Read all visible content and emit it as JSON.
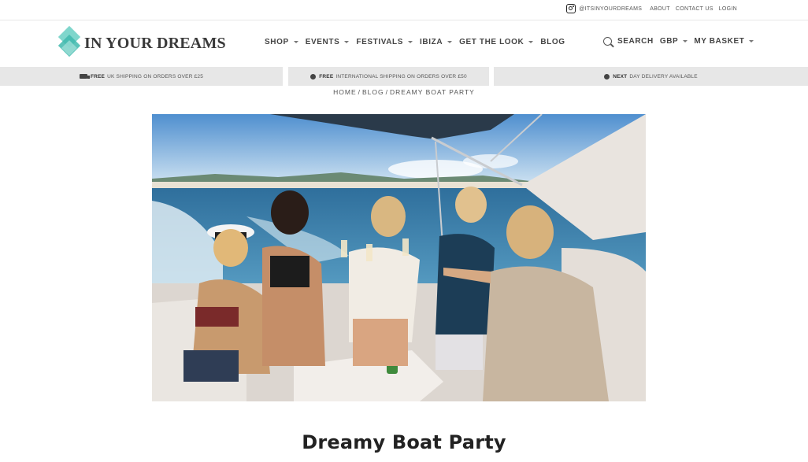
{
  "topbar": {
    "instagram_handle": "@ITSINYOURDREAMS",
    "links": [
      "ABOUT",
      "CONTACT US",
      "LOGIN"
    ]
  },
  "brand": {
    "name": "IN YOUR DREAMS",
    "accent_color": "#3fb8ad"
  },
  "nav": {
    "items": [
      {
        "label": "SHOP",
        "has_dropdown": true
      },
      {
        "label": "EVENTS",
        "has_dropdown": true
      },
      {
        "label": "FESTIVALS",
        "has_dropdown": true
      },
      {
        "label": "IBIZA",
        "has_dropdown": true
      },
      {
        "label": "GET THE LOOK",
        "has_dropdown": true
      },
      {
        "label": "BLOG",
        "has_dropdown": false
      }
    ],
    "search_label": "SEARCH",
    "currency_label": "GBP",
    "basket_label": "MY BASKET"
  },
  "shipping": {
    "uk": {
      "bold": "FREE",
      "text": "UK SHIPPING ON ORDERS OVER £25",
      "icon": "truck-icon"
    },
    "intl": {
      "bold": "FREE",
      "text": "INTERNATIONAL SHIPPING ON ORDERS OVER £50",
      "icon": "globe-icon"
    },
    "next": {
      "bold": "NEXT",
      "text": "DAY DELIVERY AVAILABLE",
      "icon": "clock-icon"
    }
  },
  "breadcrumb": {
    "items": [
      "HOME",
      "BLOG",
      "DREAMY BOAT PARTY"
    ],
    "separator": "/"
  },
  "post": {
    "title": "Dreamy Boat Party"
  }
}
